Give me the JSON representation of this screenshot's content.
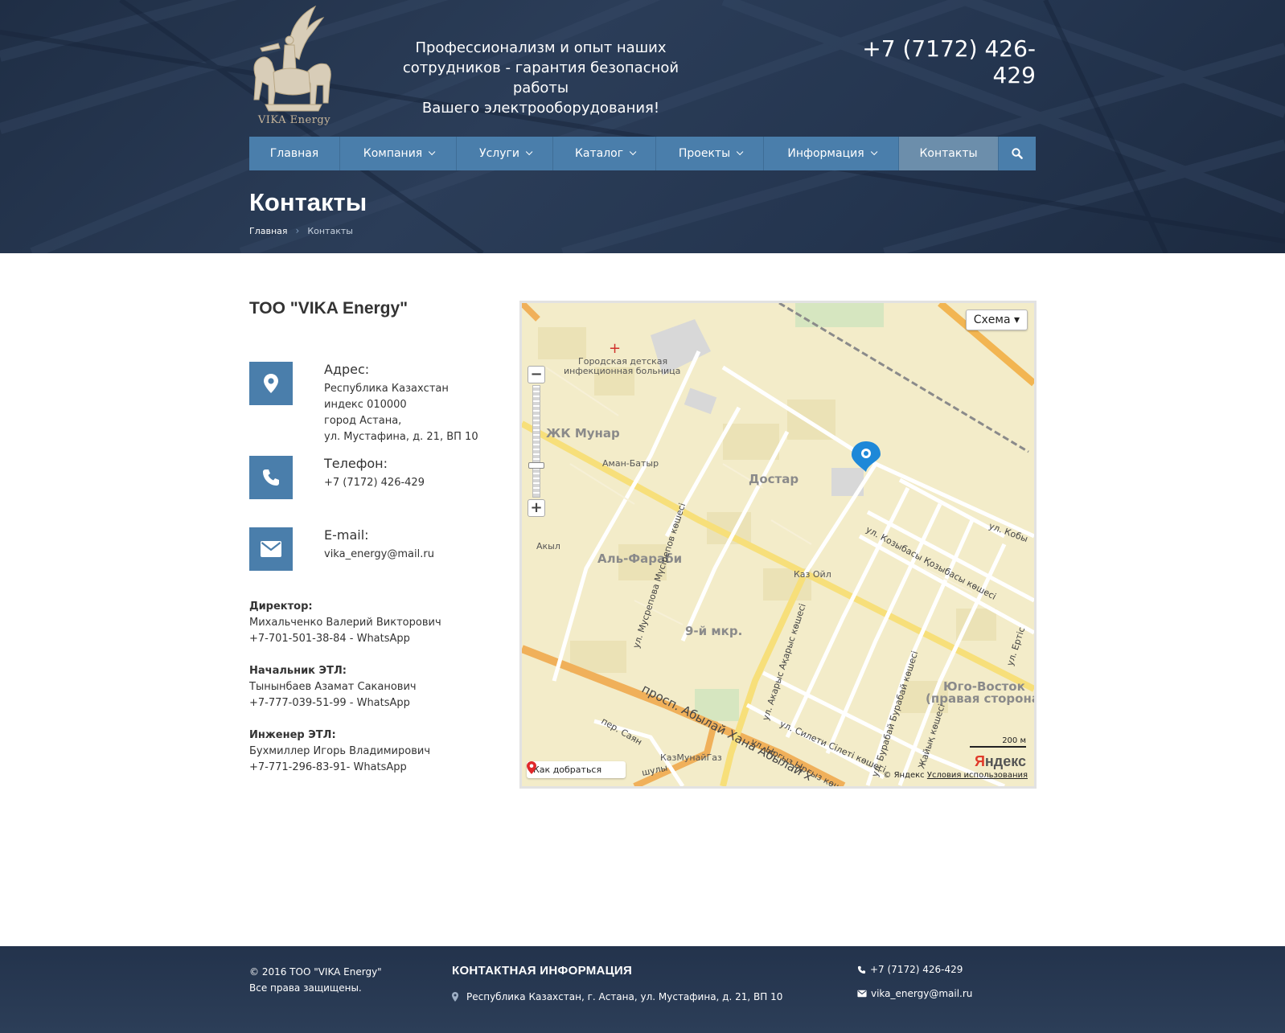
{
  "header": {
    "logo_text": "VIKA Energy",
    "slogan": [
      "Профессионализм и опыт наших",
      "сотрудников - гарантия безопасной работы",
      "Вашего электрооборудования!"
    ],
    "phone": "+7 (7172) 426-429"
  },
  "nav": {
    "items": [
      {
        "label": "Главная",
        "has_dropdown": false
      },
      {
        "label": "Компания",
        "has_dropdown": true
      },
      {
        "label": "Услуги",
        "has_dropdown": true
      },
      {
        "label": "Каталог",
        "has_dropdown": true
      },
      {
        "label": "Проекты",
        "has_dropdown": true
      },
      {
        "label": "Информация",
        "has_dropdown": true
      },
      {
        "label": "Контакты",
        "has_dropdown": false,
        "active": true
      }
    ],
    "search_icon": "search-icon"
  },
  "page": {
    "title": "Контакты",
    "breadcrumb": [
      "Главная",
      "Контакты"
    ]
  },
  "contacts": {
    "company": "ТОО \"VIKA Energy\"",
    "address": {
      "title": "Адрес:",
      "lines": [
        "Республика Казахстан",
        "индекс 010000",
        "город Астана,",
        "ул. Мустафина, д. 21, ВП 10"
      ]
    },
    "phone": {
      "title": "Телефон:",
      "value": "+7 (7172) 426-429"
    },
    "email": {
      "title": "E-mail:",
      "value": "vika_energy@mail.ru"
    }
  },
  "staff": [
    {
      "role": "Директор:",
      "name": "Михальченко Валерий Викторович",
      "phone": "+7-701-501-38-84 - WhatsApp"
    },
    {
      "role": "Начальник ЭТЛ:",
      "name": "Тынынбаев Азамат Саканович",
      "phone": "+7-777-039-51-99 - WhatsApp"
    },
    {
      "role": "Инженер ЭТЛ:",
      "name": "Бухмиллер Игорь Владимирович",
      "phone": "+7-771-296-83-91- WhatsApp"
    }
  ],
  "map": {
    "scheme_label": "Схема ▾",
    "route_label": "Как добраться",
    "scale": "200 м",
    "copyright": "© Яндекс",
    "terms": "Условия использования",
    "brand": "Яндекс",
    "labels": {
      "hospital": [
        "Городская детская",
        "инфекционная больница"
      ],
      "zk_munar": "ЖК Мунар",
      "aman_batyr": "Аман-Батыр",
      "dostar": "Достар",
      "akyl": "Акыл",
      "al_farabi": "Аль-Фараби",
      "kaz_oil": "Каз Ойл",
      "musrepov": "ул. Мусрепова Мүсірепов көшесі",
      "kozybasy": "ул. Козыбасы Қозыбасы көшесі",
      "kobyl": "ул. Кобы",
      "mkr9": "9-й мкр.",
      "abylai": "просп. Абылай Хана Абылай х",
      "sayan": "пер. Саян",
      "kazmunaigaz": "КазМунайГаз",
      "akarys": "ул. Акарыс Ақарыс көшесі",
      "yrgyz": "ул. Ыргыз Ырғыз көш",
      "sileti": "ул. Силети Сілеті көшесі",
      "burabai": "ул. Бурабай Бурабай көшесі",
      "zhaiyk": "Жайық көшесі",
      "yugo_vostok": [
        "Юго-Восток",
        "(правая сторона)"
      ],
      "ertis": "ул. Ертіс",
      "shuly": "шулы"
    }
  },
  "footer": {
    "copyright": [
      "© 2016 ТОО \"VIKA Energy\"",
      "Все права защищены."
    ],
    "heading": "КОНТАКТНАЯ ИНФОРМАЦИЯ",
    "address": "Республика Казахстан, г. Астана, ул. Мустафина, д. 21, ВП 10",
    "phone": "+7 (7172) 426-429",
    "email": "vika_energy@mail.ru"
  },
  "colors": {
    "nav_bg": "#4a7eab",
    "nav_active": "#6c8eab",
    "icon_box": "#4a7eab",
    "hero_bg": "#24354f",
    "footer_bg": "#2a3b55"
  }
}
